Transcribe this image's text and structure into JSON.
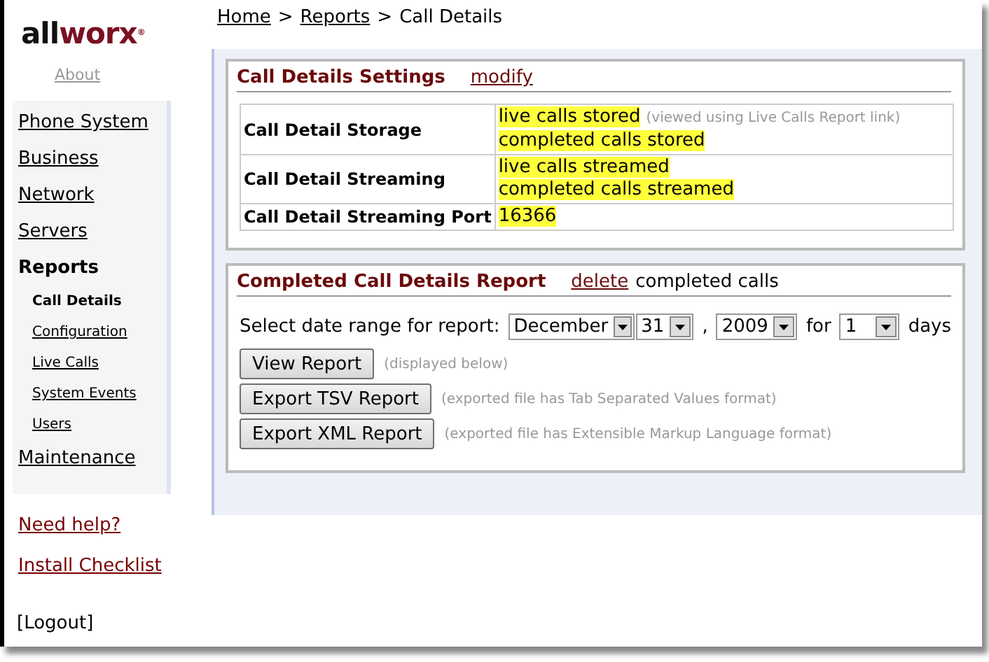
{
  "logo": {
    "parts": [
      "all",
      "worx"
    ],
    "mark": "®"
  },
  "about": "About",
  "nav": [
    {
      "label": "Phone System",
      "selected": false
    },
    {
      "label": "Business",
      "selected": false
    },
    {
      "label": "Network",
      "selected": false
    },
    {
      "label": "Servers",
      "selected": false
    },
    {
      "label": "Reports",
      "selected": true,
      "children": [
        {
          "label": "Call Details",
          "selected": true
        },
        {
          "label": "Configuration",
          "selected": false
        },
        {
          "label": "Live Calls",
          "selected": false
        },
        {
          "label": "System Events",
          "selected": false
        },
        {
          "label": "Users",
          "selected": false
        }
      ]
    },
    {
      "label": "Maintenance",
      "selected": false
    }
  ],
  "help_links": [
    "Need help?",
    "Install Checklist"
  ],
  "logout": "[Logout]",
  "breadcrumb": [
    {
      "kind": "link",
      "text": "Home"
    },
    {
      "kind": "sep",
      "text": ">"
    },
    {
      "kind": "link",
      "text": "Reports"
    },
    {
      "kind": "sep",
      "text": ">"
    },
    {
      "kind": "current",
      "text": "Call Details"
    }
  ],
  "settings": {
    "title": "Call Details Settings",
    "action": "modify",
    "rows": [
      {
        "label": "Call Detail Storage",
        "values": [
          {
            "text": "live calls stored",
            "note": "(viewed using Live Calls Report link)"
          },
          {
            "text": "completed calls stored"
          }
        ]
      },
      {
        "label": "Call Detail Streaming",
        "values": [
          {
            "text": "live calls streamed"
          },
          {
            "text": "completed calls streamed"
          }
        ]
      },
      {
        "label": "Call Detail Streaming Port",
        "values": [
          {
            "text": "16366"
          }
        ]
      }
    ]
  },
  "report": {
    "title": "Completed Call Details Report",
    "action": "delete",
    "action_suffix": "completed calls",
    "date_range": [
      {
        "kind": "label",
        "text": "Select date range for report:"
      },
      {
        "kind": "select",
        "value": "December"
      },
      {
        "kind": "select",
        "value": "31"
      },
      {
        "kind": "label",
        "text": ","
      },
      {
        "kind": "select",
        "value": "2009"
      },
      {
        "kind": "label",
        "text": "for"
      },
      {
        "kind": "select",
        "value": "1"
      },
      {
        "kind": "label",
        "text": "days"
      }
    ],
    "buttons": [
      {
        "label": "View Report",
        "note": "(displayed below)"
      },
      {
        "label": "Export TSV Report",
        "note": "(exported file has Tab Separated Values format)"
      },
      {
        "label": "Export XML Report",
        "note": "(exported file has Extensible Markup Language format)"
      }
    ]
  }
}
